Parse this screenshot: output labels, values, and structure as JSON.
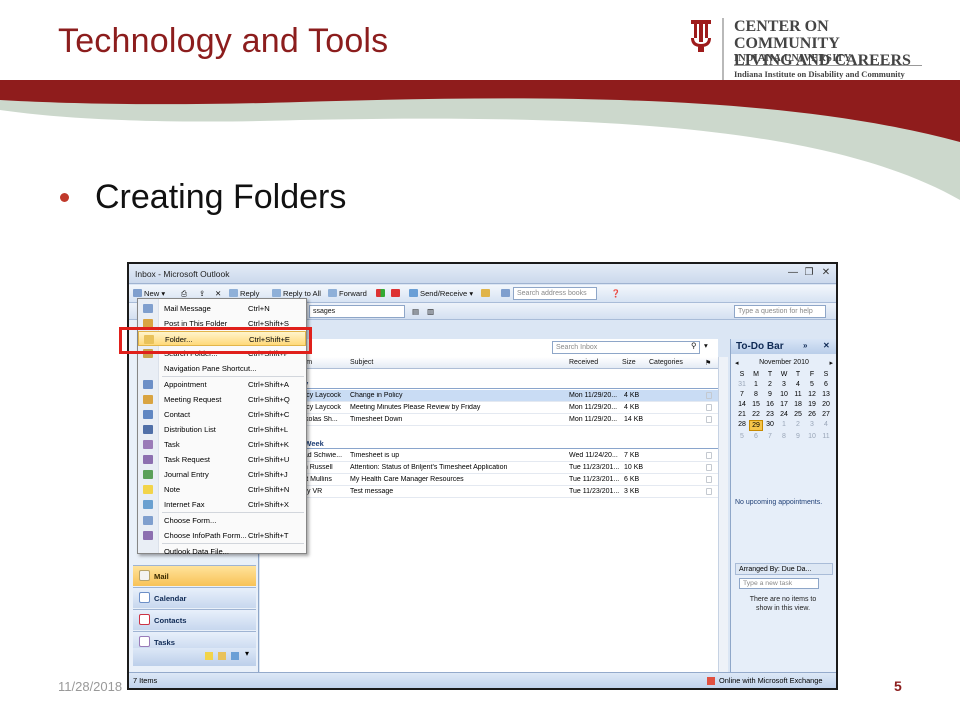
{
  "slide": {
    "title": "Technology and Tools",
    "bullet": "Creating Folders",
    "date": "11/28/2018",
    "page": "5"
  },
  "logo": {
    "line1": "CENTER ON COMMUNITY",
    "line2": "LIVING AND CAREERS",
    "line3": "INDIANA UNIVERSITY",
    "line4": "Indiana Institute on Disability and Community"
  },
  "colors": {
    "brand_red": "#8c1d1d",
    "bullet": "#c0392b",
    "highlight_box": "#e0201b",
    "menu_highlight": "#ffd979"
  },
  "window": {
    "title": "Inbox - Microsoft Outlook",
    "toolbar": {
      "new": "New",
      "reply": "Reply",
      "reply_all": "Reply to All",
      "forward": "Forward",
      "send_receive": "Send/Receive",
      "search_books_placeholder": "Search address books",
      "help_placeholder": "Type a question for help"
    },
    "toolbar2": {
      "view_value": "ssages"
    },
    "search_placeholder": "Search Inbox",
    "columns": {
      "from": "rom",
      "subject": "Subject",
      "received": "Received",
      "size": "Size",
      "categories": "Categories"
    },
    "groups": {
      "today": "ay",
      "last_week": "t Week"
    },
    "rows_today": [
      {
        "from": "racy Laycock",
        "subject": "Change in Policy",
        "received": "Mon 11/29/20...",
        "size": "4 KB"
      },
      {
        "from": "racy Laycock",
        "subject": "Meeting Minutes Please Review by Friday",
        "received": "Mon 11/29/20...",
        "size": "4 KB"
      },
      {
        "from": "ickolas Sh...",
        "subject": "Timesheet Down",
        "received": "Mon 11/29/20...",
        "size": "14 KB"
      }
    ],
    "rows_last_week": [
      {
        "from": "had Schwie...",
        "subject": "Timesheet is up",
        "received": "Wed 11/24/20...",
        "size": "7 KB"
      },
      {
        "from": "an Russell",
        "subject": "Attention: Status of Briljent's Timesheet Application",
        "received": "Tue 11/23/201...",
        "size": "10 KB"
      },
      {
        "from": "ert Mullins",
        "subject": "My Health Care Manager Resources",
        "received": "Tue 11/23/201...",
        "size": "6 KB"
      },
      {
        "from": "cky VR",
        "subject": "Test message",
        "received": "Tue 11/23/201...",
        "size": "3 KB"
      }
    ],
    "nav": {
      "mail": "Mail",
      "calendar": "Calendar",
      "contacts": "Contacts",
      "tasks": "Tasks"
    },
    "todo": {
      "title": "To-Do Bar",
      "month": "November 2010",
      "weekdays": [
        "S",
        "M",
        "T",
        "W",
        "T",
        "F",
        "S"
      ],
      "days": [
        [
          "31",
          "1",
          "2",
          "3",
          "4",
          "5",
          "6"
        ],
        [
          "7",
          "8",
          "9",
          "10",
          "11",
          "12",
          "13"
        ],
        [
          "14",
          "15",
          "16",
          "17",
          "18",
          "19",
          "20"
        ],
        [
          "21",
          "22",
          "23",
          "24",
          "25",
          "26",
          "27"
        ],
        [
          "28",
          "29",
          "30",
          "1",
          "2",
          "3",
          "4"
        ],
        [
          "5",
          "6",
          "7",
          "8",
          "9",
          "10",
          "11"
        ]
      ],
      "no_appointments": "No upcoming appointments.",
      "arranged_by": "Arranged By: Due Da...",
      "new_task_placeholder": "Type a new task",
      "no_items": "There are no items to show in this view."
    },
    "status": {
      "items": "7 Items",
      "online": "Online with Microsoft Exchange"
    },
    "menu": [
      {
        "label": "Mail Message",
        "key": "Ctrl+N",
        "icon": "mail-message-icon",
        "color": "#7f9fce"
      },
      {
        "label": "Post in This Folder",
        "key": "Ctrl+Shift+S",
        "icon": "post-icon",
        "color": "#d9a441"
      },
      {
        "label": "Folder...",
        "key": "Ctrl+Shift+E",
        "icon": "folder-icon",
        "color": "#e9c25a",
        "highlight": true
      },
      {
        "label": "Search Folder...",
        "key": "Ctrl+Shift+P",
        "icon": "search-folder-icon",
        "color": "#c9a24a"
      },
      {
        "label": "Navigation Pane Shortcut...",
        "key": "",
        "icon": "shortcut-icon",
        "color": ""
      },
      {
        "label": "Appointment",
        "key": "Ctrl+Shift+A",
        "icon": "appointment-icon",
        "color": "#6c8fc7"
      },
      {
        "label": "Meeting Request",
        "key": "Ctrl+Shift+Q",
        "icon": "meeting-icon",
        "color": "#d9a441"
      },
      {
        "label": "Contact",
        "key": "Ctrl+Shift+C",
        "icon": "contact-icon",
        "color": "#5f86c2"
      },
      {
        "label": "Distribution List",
        "key": "Ctrl+Shift+L",
        "icon": "distribution-list-icon",
        "color": "#4f6fa8"
      },
      {
        "label": "Task",
        "key": "Ctrl+Shift+K",
        "icon": "task-icon",
        "color": "#9a7bb8"
      },
      {
        "label": "Task Request",
        "key": "Ctrl+Shift+U",
        "icon": "task-request-icon",
        "color": "#8c6fb0"
      },
      {
        "label": "Journal Entry",
        "key": "Ctrl+Shift+J",
        "icon": "journal-icon",
        "color": "#5aa05a"
      },
      {
        "label": "Note",
        "key": "Ctrl+Shift+N",
        "icon": "note-icon",
        "color": "#f2d44a"
      },
      {
        "label": "Internet Fax",
        "key": "Ctrl+Shift+X",
        "icon": "fax-icon",
        "color": "#6aa0d0"
      },
      {
        "label": "Choose Form...",
        "key": "",
        "icon": "form-icon",
        "color": "#7f9fce"
      },
      {
        "label": "Choose InfoPath Form...",
        "key": "Ctrl+Shift+T",
        "icon": "infopath-icon",
        "color": "#8c6fb0"
      },
      {
        "label": "Outlook Data File...",
        "key": "",
        "icon": "data-file-icon",
        "color": ""
      }
    ]
  }
}
